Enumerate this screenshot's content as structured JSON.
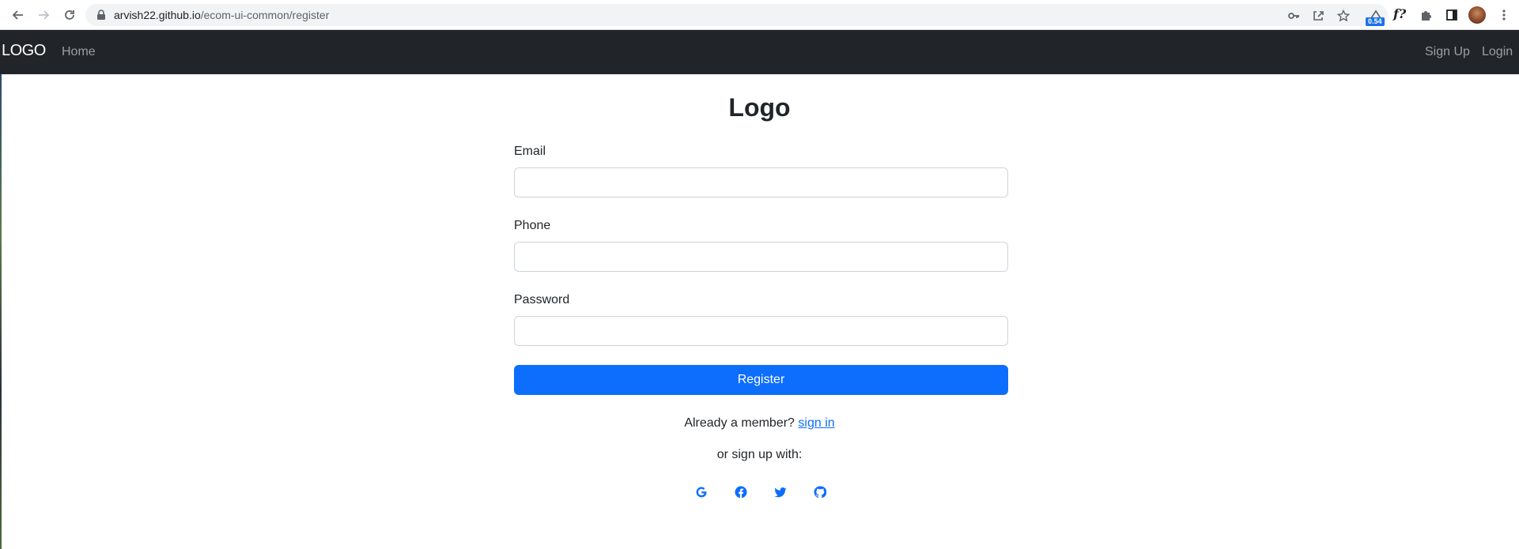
{
  "browser": {
    "url_host": "arvish22.github.io",
    "url_path": "/ecom-ui-common/register",
    "extension_badge": "0.54",
    "fx_label": "f?",
    "icons": [
      "back-arrow-icon",
      "forward-arrow-icon",
      "reload-icon",
      "lock-icon",
      "key-icon",
      "share-icon",
      "star-icon",
      "extension-icon",
      "puzzle-icon",
      "side-panel-icon",
      "avatar",
      "kebab-menu-icon"
    ]
  },
  "navbar": {
    "brand": "LOGO",
    "links": {
      "home": "Home",
      "signup": "Sign Up",
      "login": "Login"
    }
  },
  "form": {
    "title": "Logo",
    "email": {
      "label": "Email",
      "value": ""
    },
    "phone": {
      "label": "Phone",
      "value": ""
    },
    "password": {
      "label": "Password",
      "value": ""
    },
    "register_label": "Register",
    "member_prefix": "Already a member?",
    "signin_link": "sign in",
    "signup_with": "or sign up with:",
    "social": [
      "google-icon",
      "facebook-icon",
      "twitter-icon",
      "github-icon"
    ]
  },
  "colors": {
    "navbar_bg": "#212529",
    "primary": "#0d6efd",
    "social_icon": "#0d6efd"
  }
}
